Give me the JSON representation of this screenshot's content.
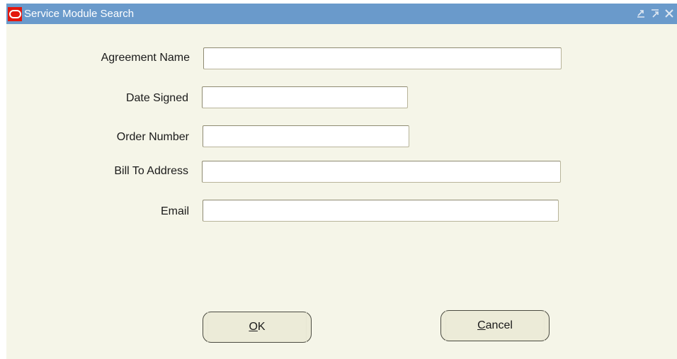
{
  "window": {
    "title": "Service Module Search",
    "logo_icon": "oracle-logo-icon",
    "controls": [
      "minimize-icon",
      "maximize-icon",
      "close-icon"
    ],
    "titlebar_color": "#6a9acb"
  },
  "form": {
    "agreement_name": {
      "label": "Agreement Name",
      "value": ""
    },
    "date_signed": {
      "label": "Date Signed",
      "value": ""
    },
    "order_number": {
      "label": "Order Number",
      "value": ""
    },
    "bill_to_address": {
      "label": "Bill To Address",
      "value": ""
    },
    "email": {
      "label": "Email",
      "value": ""
    }
  },
  "buttons": {
    "ok": {
      "mnemonic": "O",
      "rest": "K"
    },
    "cancel": {
      "mnemonic": "C",
      "rest": "ancel"
    }
  }
}
